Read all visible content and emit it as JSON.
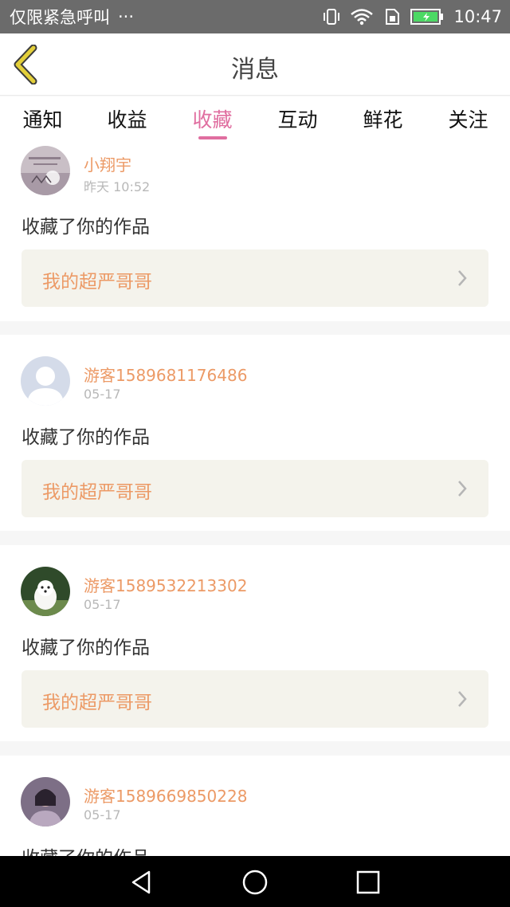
{
  "status_bar": {
    "carrier": "仅限紧急呼叫",
    "more": "···",
    "time": "10:47",
    "icons": [
      "vibrate-icon",
      "wifi-icon",
      "sim-icon",
      "battery-icon"
    ]
  },
  "header": {
    "title": "消息",
    "back_icon": "chevron-left-icon",
    "accent": "#e3cf3a"
  },
  "tabs": {
    "items": [
      {
        "label": "通知"
      },
      {
        "label": "收益"
      },
      {
        "label": "收藏"
      },
      {
        "label": "互动"
      },
      {
        "label": "鲜花"
      },
      {
        "label": "关注"
      }
    ],
    "active": "收藏",
    "active_color": "#e06ea0"
  },
  "feed": {
    "items": [
      {
        "username": "小翔宇",
        "time": "昨天 10:52",
        "action": "收藏了你的作品",
        "work": "我的超严哥哥"
      },
      {
        "username": "游客1589681176486",
        "time": "05-17",
        "action": "收藏了你的作品",
        "work": "我的超严哥哥"
      },
      {
        "username": "游客1589532213302",
        "time": "05-17",
        "action": "收藏了你的作品",
        "work": "我的超严哥哥"
      },
      {
        "username": "游客1589669850228",
        "time": "05-17",
        "action": "收藏了你的作品",
        "work": ""
      }
    ]
  },
  "colors": {
    "username": "#ec9a66",
    "link_bg": "#f4f3ec",
    "status_bar": "#6b6b6b"
  },
  "nav": {
    "icons": [
      "back-triangle-icon",
      "home-circle-icon",
      "recents-square-icon"
    ]
  }
}
